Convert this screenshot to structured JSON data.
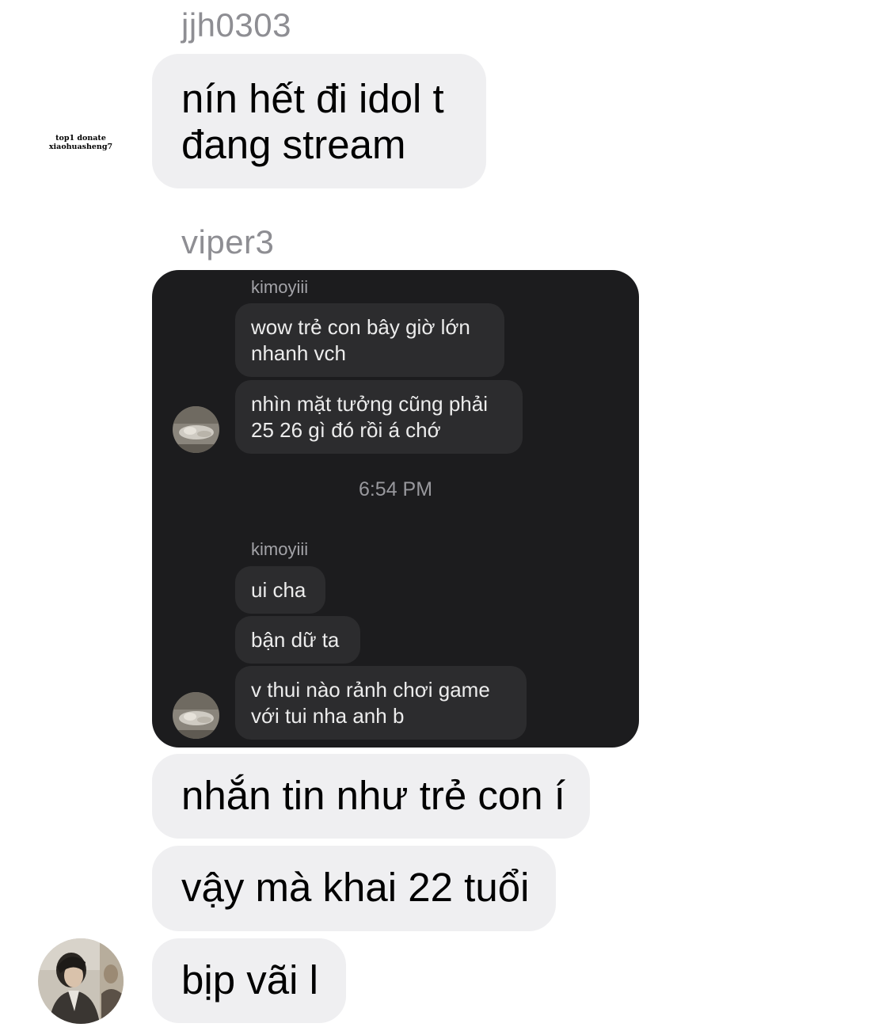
{
  "watermark": {
    "line1": "top1 donate",
    "line2": "xiaohuasheng7"
  },
  "messages": {
    "sender1": "jjh0303",
    "bubble1_line1": "nín hết đi idol t",
    "bubble1_line2": "đang stream",
    "sender2": "viper3",
    "bubble_after1": "nhắn tin như trẻ con í",
    "bubble_after2": "vậy mà khai 22 tuổi",
    "bubble_after3": "bịp vãi l"
  },
  "shared_screenshot": {
    "group1_sender": "kimoyiii",
    "group1_msg1_line1": "wow trẻ con bây giờ lớn",
    "group1_msg1_line2": "nhanh vch",
    "group1_msg2_line1": "nhìn mặt tưởng cũng phải",
    "group1_msg2_line2": "25 26 gì đó rồi á chớ",
    "timestamp": "6:54 PM",
    "group2_sender": "kimoyiii",
    "group2_msg1": "ui cha",
    "group2_msg2": "bận dữ ta",
    "group2_msg3_line1": "v thui nào rảnh chơi game",
    "group2_msg3_line2": "với tui nha anh b"
  },
  "colors": {
    "bubble_light": "#efeff1",
    "sender_gray": "#8e8e93",
    "dark_background": "#1c1c1e",
    "dark_bubble": "#2c2c2e"
  },
  "icons": {
    "sender_avatar": "profile-photo",
    "quoted_avatar": "profile-photo"
  }
}
